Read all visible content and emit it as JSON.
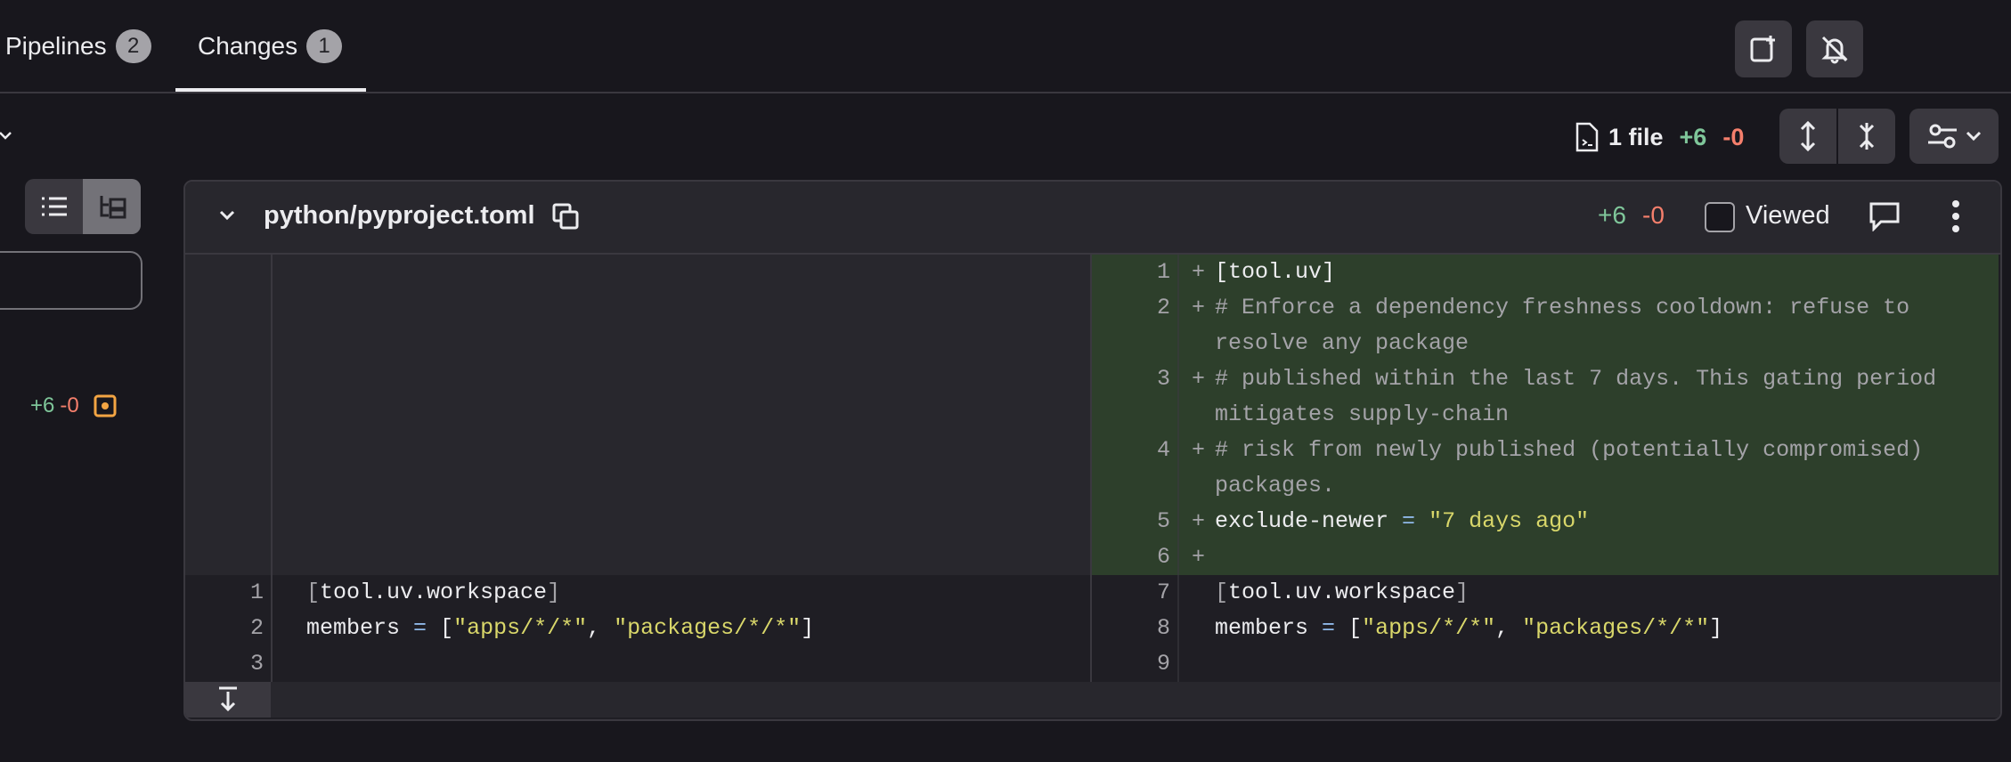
{
  "tabs": [
    {
      "label": "Pipelines",
      "count": "2"
    },
    {
      "label": "Changes",
      "count": "1"
    }
  ],
  "toolbar": {
    "file_count": "1 file",
    "additions": "+6",
    "deletions": "-0"
  },
  "sidebar": {
    "file_additions": "+6",
    "file_deletions": "-0"
  },
  "file": {
    "path": "python/pyproject.toml",
    "additions": "+6",
    "deletions": "-0",
    "viewed_label": "Viewed"
  },
  "diff": {
    "added": [
      {
        "n": "1",
        "text": "[tool.uv]"
      },
      {
        "n": "2",
        "text": "# Enforce a dependency freshness cooldown: refuse to",
        "cont": "resolve any package"
      },
      {
        "n": "3",
        "text": "# published within the last 7 days. This gating period",
        "cont": "mitigates supply-chain"
      },
      {
        "n": "4",
        "text": "# risk from newly published (potentially compromised)",
        "cont": "packages."
      },
      {
        "n": "5",
        "key": "exclude-newer",
        "eq": " = ",
        "val": "\"7 days ago\""
      },
      {
        "n": "6",
        "text": ""
      }
    ],
    "context": [
      {
        "old": "1",
        "new": "7",
        "text": "[tool.uv.workspace]"
      },
      {
        "old": "2",
        "new": "8",
        "key": "members",
        "eq": " = ",
        "open": "[",
        "s1": "\"apps/*/*\"",
        "sep": ", ",
        "s2": "\"packages/*/*\"",
        "close": "]"
      },
      {
        "old": "3",
        "new": "9",
        "text": ""
      }
    ]
  },
  "colors": {
    "added_bg": "#2d3f2b",
    "accent_green": "#7fc69a",
    "accent_red": "#f57f6c",
    "orange": "#f3a543"
  }
}
